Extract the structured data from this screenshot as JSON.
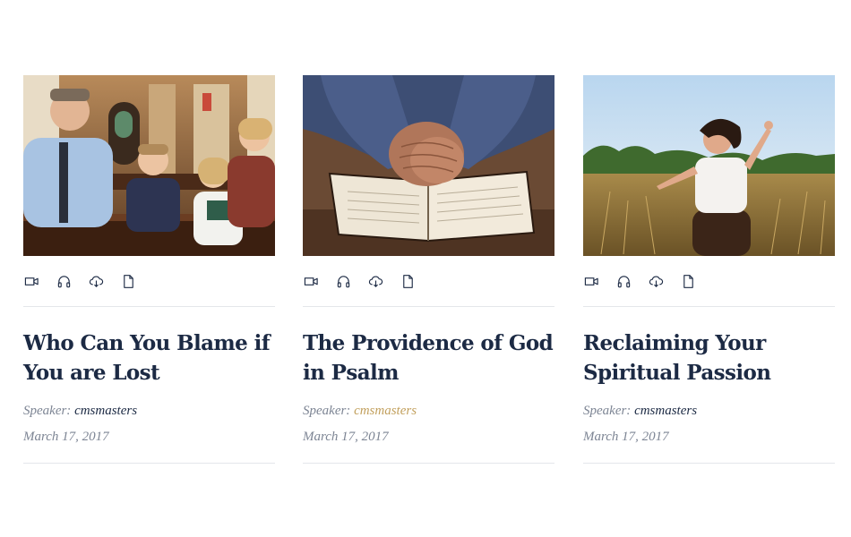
{
  "cards": [
    {
      "title": "Who Can You Blame if You are Lost",
      "speaker_label": "Speaker:",
      "speaker_name": "cmsmasters",
      "date": "March 17, 2017",
      "image": "church-family-photo"
    },
    {
      "title": "The Providence of God in Psalm",
      "speaker_label": "Speaker:",
      "speaker_name": "cmsmasters",
      "date": "March 17, 2017",
      "image": "praying-hands-bible-photo"
    },
    {
      "title": "Reclaiming Your Spiritual Passion",
      "speaker_label": "Speaker:",
      "speaker_name": "cmsmasters",
      "date": "March 17, 2017",
      "image": "woman-field-photo"
    }
  ],
  "icons": [
    "video-icon",
    "headphones-icon",
    "download-cloud-icon",
    "document-icon"
  ],
  "colors": {
    "title": "#1c2a44",
    "meta": "#7d8594",
    "accent_gold": "#c2a05d",
    "divider": "#e4e6ea"
  }
}
